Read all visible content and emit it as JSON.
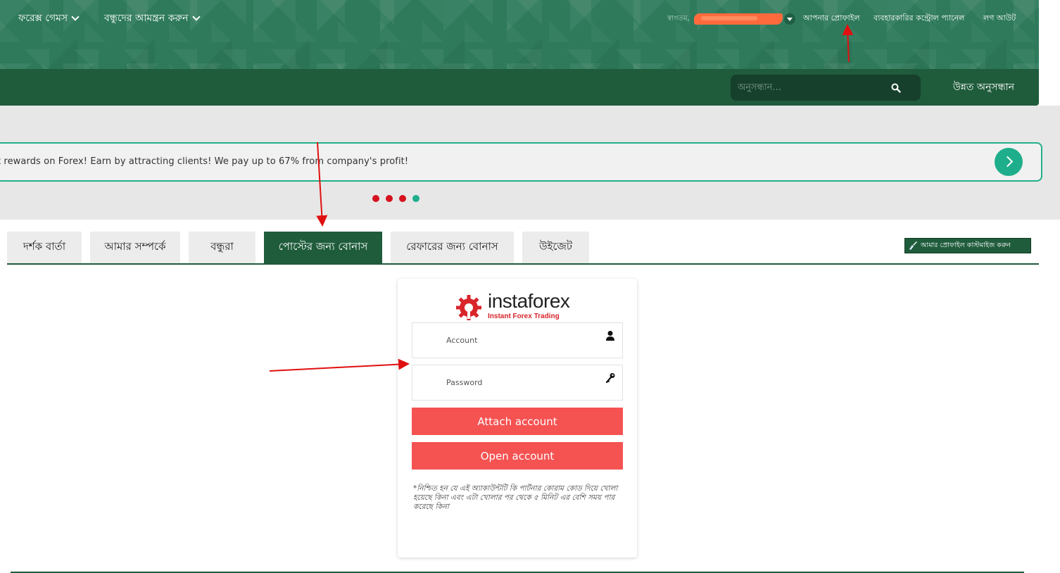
{
  "header": {
    "greeting": "স্বাগতম,",
    "username_redacted": "",
    "links": {
      "profile": "আপনার প্রোফাইল",
      "control_panel": "ব্যবহারকারির কন্ট্রোল প্যানেল",
      "logout": "লগ আউট"
    }
  },
  "nav": {
    "items": [
      {
        "label": "ফরেক্স গেমস"
      },
      {
        "label": "বন্ধুদের আমন্ত্রন করুন"
      }
    ],
    "search": {
      "placeholder": "অনুসন্ধান..."
    },
    "advanced_search": "উন্নত অনুসন্ধান"
  },
  "banner": {
    "text": "t rewards on Forex! Earn by attracting clients! We pay up to 67% from company's profit!",
    "dots": 4,
    "active_dot": 4
  },
  "tabs": [
    {
      "label": "দর্শক বার্তা",
      "active": false
    },
    {
      "label": "আমার সম্পর্কে",
      "active": false
    },
    {
      "label": "বন্ধুরা",
      "active": false
    },
    {
      "label": "পোস্টের জন্য বোনাস",
      "active": true
    },
    {
      "label": "রেফারের জন্য বোনাস",
      "active": false
    },
    {
      "label": "উইজেট",
      "active": false
    }
  ],
  "customize_profile": "আমার প্রোফাইল কাস্টমাইজ করুন",
  "login_card": {
    "logo_text": "instaforex",
    "logo_tagline": "Instant Forex Trading",
    "account_placeholder": "Account",
    "password_placeholder": "Password",
    "attach_button": "Attach account",
    "open_button": "Open account",
    "note": "*নিশ্চিত হন যে এই অ্যাকাউন্টটি কি পার্টনার কোরাম কোড দিয়ে খোলা হয়েছে কিনা এবং এটা খোলার পর থেকে ৫ মিনিট এর বেশি সময় পার করেছে কিনা"
  },
  "colors": {
    "header_green": "#2e7a5b",
    "nav_green": "#1f5c3c",
    "accent_teal": "#1fae8b",
    "button_red": "#f55252",
    "dot_red": "#d6121e",
    "annotation_arrow": "#e01010"
  }
}
